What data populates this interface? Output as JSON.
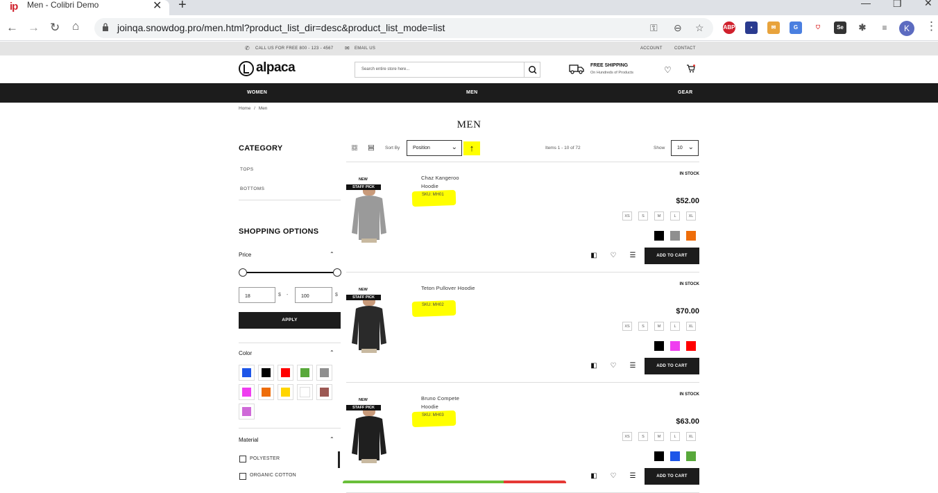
{
  "browser": {
    "tab_title": "Men - Colibri Demo",
    "favicon_text": "ip",
    "url": "joinqa.snowdog.pro/men.html?product_list_dir=desc&product_list_mode=list",
    "profile_initial": "K"
  },
  "site": {
    "topbar": {
      "phone": "CALL US FOR FREE 800 - 123 - 4567",
      "email": "EMAIL US",
      "account": "ACCOUNT",
      "contact": "CONTACT"
    },
    "logo": "alpaca",
    "search_placeholder": "Search entire store here...",
    "shipping": {
      "title": "FREE SHIPPING",
      "subtitle": "On Hundreds of Products"
    },
    "nav": [
      "WOMEN",
      "MEN",
      "GEAR"
    ],
    "breadcrumb": {
      "home": "Home",
      "sep": "/",
      "current": "Men"
    },
    "page_title": "MEN"
  },
  "sidebar": {
    "category_title": "CATEGORY",
    "categories": [
      "TOPS",
      "BOTTOMS"
    ],
    "options_title": "SHOPPING OPTIONS",
    "price": {
      "label": "Price",
      "min": "18",
      "max": "100",
      "currency": "$",
      "dash": "-",
      "apply": "APPLY"
    },
    "color_label": "Color",
    "colors": [
      "#1e56e8",
      "#000000",
      "#ff0000",
      "#58a83a",
      "#8f8f8f",
      "#ef3ef0",
      "#ee6d0a",
      "#ffd500",
      "#ffffff",
      "#9c5853",
      "#cf6ad8"
    ],
    "material_label": "Material",
    "materials": [
      "POLYESTER",
      "ORGANIC COTTON"
    ]
  },
  "toolbar": {
    "sort_label": "Sort By",
    "sort_value": "Position",
    "sort_dir_icon": "↑",
    "items": "Items 1 - 10 of 72",
    "show_label": "Show",
    "show_value": "10"
  },
  "products": [
    {
      "badge_new": "NEW",
      "badge_pick": "STAFF PICK",
      "name": "Chaz Kangeroo Hoodie",
      "sku": "SKU: MH01",
      "stock": "IN STOCK",
      "price": "$52.00",
      "sizes": [
        "XS",
        "S",
        "M",
        "L",
        "XL"
      ],
      "colors": [
        "#000000",
        "#8f8f8f",
        "#ee6d0a"
      ],
      "add_to_cart": "ADD TO CART",
      "hoodie_color": "#9a9a9a"
    },
    {
      "badge_new": "NEW",
      "badge_pick": "STAFF PICK",
      "name": "Teton Pullover Hoodie",
      "sku": "SKU: MH02",
      "stock": "IN STOCK",
      "price": "$70.00",
      "sizes": [
        "XS",
        "S",
        "M",
        "L",
        "XL"
      ],
      "colors": [
        "#000000",
        "#ef3ef0",
        "#ff0000"
      ],
      "add_to_cart": "ADD TO CART",
      "hoodie_color": "#2a2a2a"
    },
    {
      "badge_new": "NEW",
      "badge_pick": "STAFF PICK",
      "name": "Bruno Compete Hoodie",
      "sku": "SKU: MH03",
      "stock": "IN STOCK",
      "price": "$63.00",
      "sizes": [
        "XS",
        "S",
        "M",
        "L",
        "XL"
      ],
      "colors": [
        "#000000",
        "#1e56e8",
        "#58a83a"
      ],
      "add_to_cart": "ADD TO CART",
      "hoodie_color": "#1f1f1f"
    }
  ]
}
